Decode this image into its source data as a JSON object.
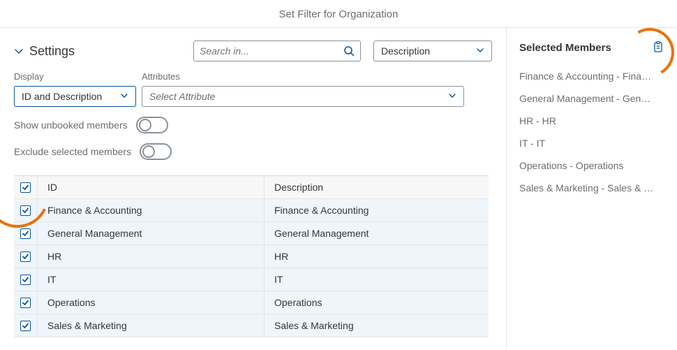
{
  "title": "Set Filter for Organization",
  "settings": {
    "label": "Settings",
    "displayLabel": "Display",
    "displayValue": "ID and Description",
    "attributesLabel": "Attributes",
    "attributesPlaceholder": "Select Attribute",
    "showUnbookedLabel": "Show unbooked members",
    "excludeLabel": "Exclude selected members"
  },
  "search": {
    "placeholder": "Search in..."
  },
  "viewSelect": {
    "value": "Description"
  },
  "table": {
    "headers": {
      "id": "ID",
      "description": "Description"
    },
    "rows": [
      {
        "id": "Finance & Accounting",
        "description": "Finance & Accounting"
      },
      {
        "id": "General Management",
        "description": "General Management"
      },
      {
        "id": "HR",
        "description": "HR"
      },
      {
        "id": "IT",
        "description": "IT"
      },
      {
        "id": "Operations",
        "description": "Operations"
      },
      {
        "id": "Sales & Marketing",
        "description": "Sales & Marketing"
      }
    ]
  },
  "selectedPanel": {
    "title": "Selected Members",
    "items": [
      "Finance & Accounting - Fina…",
      "General Management - Gen…",
      "HR - HR",
      "IT - IT",
      "Operations - Operations",
      "Sales & Marketing - Sales & …"
    ]
  }
}
